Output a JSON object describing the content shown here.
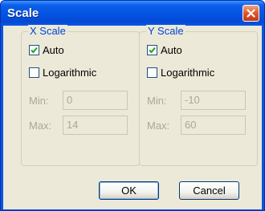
{
  "dialog": {
    "title": "Scale"
  },
  "x_scale": {
    "legend": "X Scale",
    "auto_label": "Auto",
    "auto_checked": true,
    "log_label": "Logarithmic",
    "log_checked": false,
    "min_label": "Min:",
    "min_value": "0",
    "max_label": "Max:",
    "max_value": "14"
  },
  "y_scale": {
    "legend": "Y Scale",
    "auto_label": "Auto",
    "auto_checked": true,
    "log_label": "Logarithmic",
    "log_checked": false,
    "min_label": "Min:",
    "min_value": "-10",
    "max_label": "Max:",
    "max_value": "60"
  },
  "buttons": {
    "ok_label": "OK",
    "cancel_label": "Cancel"
  },
  "icons": {
    "close": "close-icon",
    "check": "checkmark-icon"
  },
  "colors": {
    "title_bar": "#0553e3",
    "close_button": "#e2542a",
    "group_legend": "#0046d5",
    "dialog_face": "#ece9d8",
    "disabled_text": "#aca899"
  }
}
